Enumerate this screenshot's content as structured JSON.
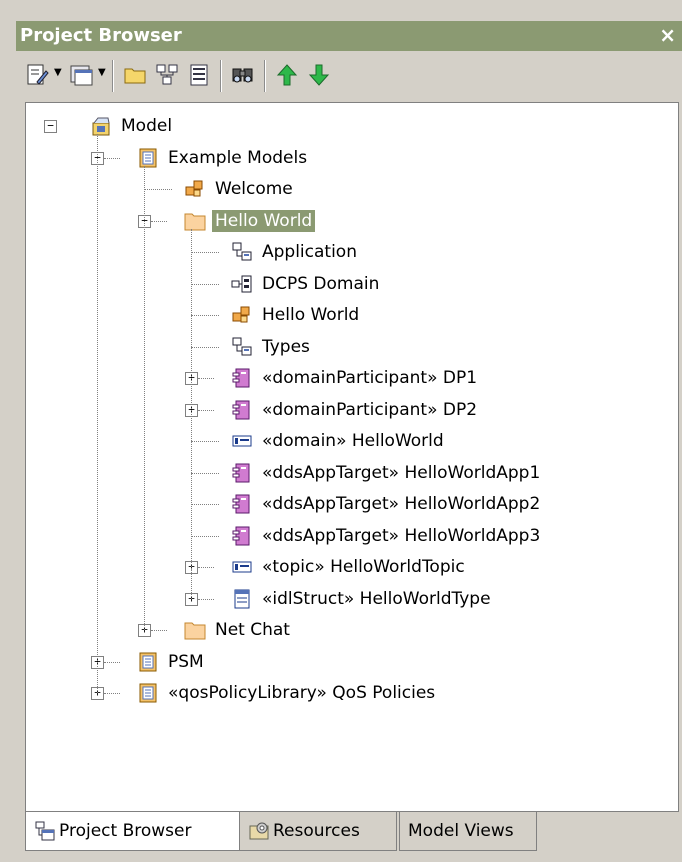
{
  "panel": {
    "title": "Project Browser",
    "close_glyph": "×"
  },
  "toolbar": {
    "buttons": [
      {
        "name": "new-element-icon",
        "dropdown": true
      },
      {
        "name": "new-diagram-icon",
        "dropdown": true
      },
      {
        "name": "new-package-icon",
        "dropdown": false
      },
      {
        "name": "model-tree-icon",
        "dropdown": false
      },
      {
        "name": "properties-icon",
        "dropdown": false
      },
      {
        "name": "find-icon",
        "dropdown": false
      },
      {
        "name": "move-up-icon",
        "dropdown": false
      },
      {
        "name": "move-down-icon",
        "dropdown": false
      }
    ]
  },
  "tree": {
    "rows": [
      {
        "label": "Model",
        "level": 0,
        "expander": "minus",
        "icon": "model-root-icon"
      },
      {
        "label": "Example Models",
        "level": 1,
        "expander": "minus",
        "icon": "package-icon"
      },
      {
        "label": "Welcome",
        "level": 2,
        "expander": null,
        "icon": "diagram-icon"
      },
      {
        "label": "Hello World",
        "level": 2,
        "expander": "minus",
        "icon": "folder-icon",
        "selected": true
      },
      {
        "label": "Application",
        "level": 3,
        "expander": null,
        "icon": "class-diagram-icon"
      },
      {
        "label": "DCPS Domain",
        "level": 3,
        "expander": null,
        "icon": "deployment-icon"
      },
      {
        "label": "Hello World",
        "level": 3,
        "expander": null,
        "icon": "diagram-icon"
      },
      {
        "label": "Types",
        "level": 3,
        "expander": null,
        "icon": "class-diagram-icon"
      },
      {
        "label": "«domainParticipant» DP1",
        "level": 3,
        "expander": "plus",
        "icon": "component-icon"
      },
      {
        "label": "«domainParticipant» DP2",
        "level": 3,
        "expander": "plus",
        "icon": "component-icon"
      },
      {
        "label": "«domain» HelloWorld",
        "level": 3,
        "expander": null,
        "icon": "node-icon"
      },
      {
        "label": "«ddsAppTarget» HelloWorldApp1",
        "level": 3,
        "expander": null,
        "icon": "component-icon"
      },
      {
        "label": "«ddsAppTarget» HelloWorldApp2",
        "level": 3,
        "expander": null,
        "icon": "component-icon"
      },
      {
        "label": "«ddsAppTarget» HelloWorldApp3",
        "level": 3,
        "expander": null,
        "icon": "component-icon"
      },
      {
        "label": "«topic» HelloWorldTopic",
        "level": 3,
        "expander": "plus",
        "icon": "node-icon"
      },
      {
        "label": "«idlStruct» HelloWorldType",
        "level": 3,
        "expander": "plus",
        "icon": "class-icon"
      },
      {
        "label": "Net Chat",
        "level": 2,
        "expander": "plus",
        "icon": "folder-icon"
      },
      {
        "label": "PSM",
        "level": 1,
        "expander": "plus",
        "icon": "package-icon"
      },
      {
        "label": "«qosPolicyLibrary» QoS Policies",
        "level": 1,
        "expander": "plus",
        "icon": "package-icon"
      }
    ]
  },
  "tabs": [
    {
      "label": "Project Browser",
      "icon": "project-browser-icon",
      "active": true
    },
    {
      "label": "Resources",
      "icon": "resources-icon",
      "active": false
    },
    {
      "label": "Model Views",
      "icon": null,
      "active": false
    }
  ]
}
